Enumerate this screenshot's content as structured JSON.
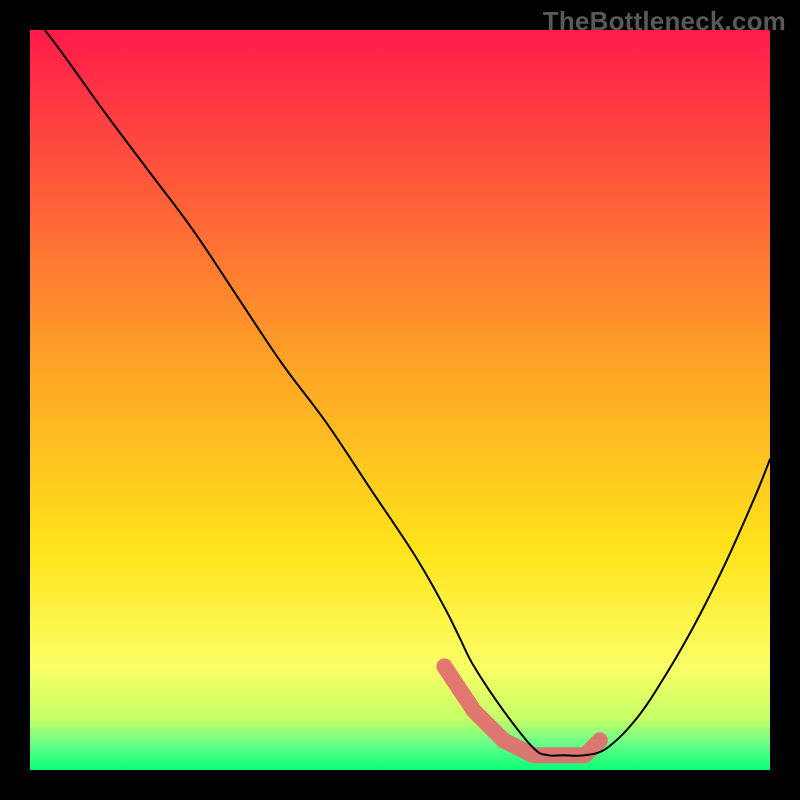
{
  "watermark": "TheBottleneck.com",
  "chart_data": {
    "type": "line",
    "title": "",
    "xlabel": "",
    "ylabel": "",
    "xlim": [
      0,
      100
    ],
    "ylim": [
      0,
      100
    ],
    "grid": false,
    "legend": false,
    "gradient_stops": [
      {
        "offset": 0,
        "color": "#ff1a4b"
      },
      {
        "offset": 0.46,
        "color": "#ffa526"
      },
      {
        "offset": 0.7,
        "color": "#ffe31a"
      },
      {
        "offset": 0.86,
        "color": "#fbff66"
      },
      {
        "offset": 0.93,
        "color": "#c6ff66"
      },
      {
        "offset": 0.965,
        "color": "#66ff8a"
      },
      {
        "offset": 1.0,
        "color": "#0bff77"
      }
    ],
    "series": [
      {
        "name": "bottleneck-curve",
        "x": [
          2,
          5,
          10,
          16,
          22,
          28,
          34,
          40,
          46,
          52,
          56,
          58,
          60,
          64,
          68,
          70,
          72,
          75,
          78,
          82,
          86,
          90,
          94,
          98,
          100
        ],
        "y": [
          100,
          96,
          89,
          81,
          73,
          64,
          55,
          47,
          38,
          29,
          22,
          18,
          14,
          8,
          3,
          2,
          2,
          2,
          3,
          7,
          13,
          20,
          28,
          37,
          42
        ]
      }
    ],
    "highlight_band": {
      "name": "optimal-range",
      "x": [
        56,
        60,
        64,
        68,
        72,
        75,
        77
      ],
      "y": [
        14,
        8,
        4,
        2,
        2,
        2,
        4
      ]
    }
  }
}
